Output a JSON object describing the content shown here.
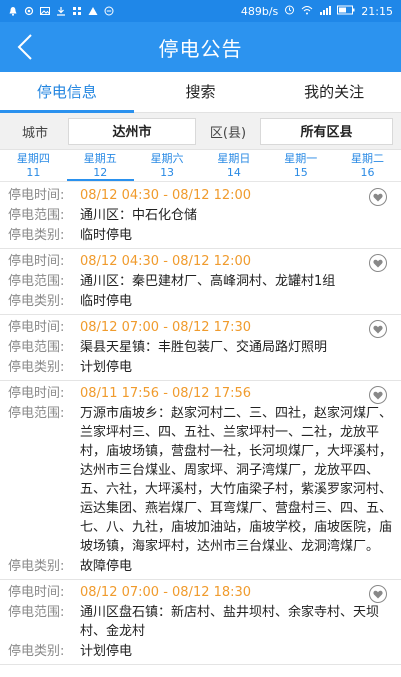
{
  "status_bar": {
    "speed": "489b/s",
    "time": "21:15"
  },
  "header": {
    "title": "停电公告"
  },
  "tabs": [
    {
      "label": "停电信息"
    },
    {
      "label": "搜索"
    },
    {
      "label": "我的关注"
    }
  ],
  "filters": {
    "city_label": "城市",
    "city_value": "达州市",
    "county_label": "区(县)",
    "county_value": "所有区县"
  },
  "days": [
    {
      "weekday": "星期四",
      "date": "11"
    },
    {
      "weekday": "星期五",
      "date": "12"
    },
    {
      "weekday": "星期六",
      "date": "13"
    },
    {
      "weekday": "星期日",
      "date": "14"
    },
    {
      "weekday": "星期一",
      "date": "15"
    },
    {
      "weekday": "星期二",
      "date": "16"
    }
  ],
  "labels": {
    "time": "停电时间:",
    "range": "停电范围:",
    "type": "停电类别:"
  },
  "notices": [
    {
      "time": "08/12 04:30 - 08/12 12:00",
      "range": "通川区：中石化仓储",
      "type": "临时停电"
    },
    {
      "time": "08/12 04:30 - 08/12 12:00",
      "range": "通川区：秦巴建材厂、高峰洞村、龙罐村1组",
      "type": "临时停电"
    },
    {
      "time": "08/12 07:00 - 08/12 17:30",
      "range": "渠县天星镇：丰胜包装厂、交通局路灯照明",
      "type": "计划停电"
    },
    {
      "time": "08/11 17:56 - 08/12 17:56",
      "range": "万源市庙坡乡：赵家河村二、三、四社，赵家河煤厂、兰家坪村三、四、五社、兰家坪村一、二社，龙放平村，庙坡场镇，营盘村一社，长河坝煤厂，大坪溪村，达州市三台煤业、周家坪、洞子湾煤厂，龙放平四、五、六社，大坪溪村，大竹庙梁子村，紫溪罗家河村、运达集团、燕岩煤厂、耳弯煤厂、营盘村三、四、五、七、八、九社，庙坡加油站，庙坡学校，庙坡医院，庙坡场镇，海家坪村，达州市三台煤业、龙洞湾煤厂。",
      "type": "故障停电"
    },
    {
      "time": "08/12 07:00 - 08/12 18:30",
      "range": "通川区盘石镇：新店村、盐井坝村、余家寺村、天坝村、金龙村",
      "type": "计划停电"
    }
  ]
}
